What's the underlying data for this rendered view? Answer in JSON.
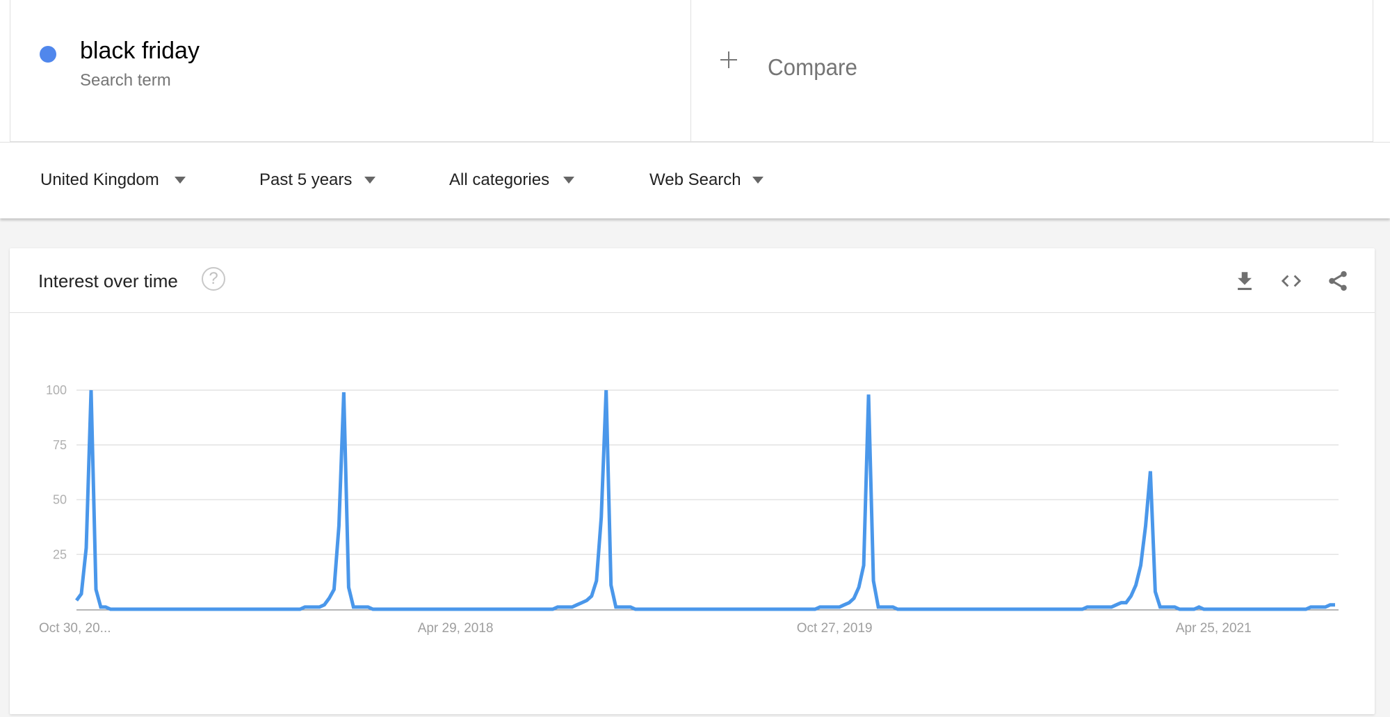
{
  "search_term": {
    "label": "black friday",
    "type_label": "Search term",
    "color": "#5087ec"
  },
  "compare": {
    "label": "Compare",
    "icon": "plus-icon"
  },
  "filters": [
    {
      "label": "United Kingdom",
      "icon": "caret-down-icon"
    },
    {
      "label": "Past 5 years",
      "icon": "caret-down-icon"
    },
    {
      "label": "All categories",
      "icon": "caret-down-icon"
    },
    {
      "label": "Web Search",
      "icon": "caret-down-icon"
    }
  ],
  "panel": {
    "title": "Interest over time",
    "help_icon": "?",
    "actions": [
      {
        "name": "download",
        "icon": "download-icon"
      },
      {
        "name": "embed",
        "icon": "code-icon"
      },
      {
        "name": "share",
        "icon": "share-icon"
      }
    ]
  },
  "chart_data": {
    "type": "line",
    "title": "Interest over time",
    "xlabel": "",
    "ylabel": "",
    "ylim": [
      0,
      100
    ],
    "grid": true,
    "y_ticks": [
      100,
      75,
      50,
      25
    ],
    "x_tick_labels": [
      {
        "label": "Oct 30, 20...",
        "index": 0
      },
      {
        "label": "Apr 29, 2018",
        "index": 78
      },
      {
        "label": "Oct 27, 2019",
        "index": 156
      },
      {
        "label": "Apr 25, 2021",
        "index": 234
      }
    ],
    "line_color": "#4a97ea",
    "series": [
      {
        "name": "black friday",
        "values": [
          4,
          7,
          28,
          100,
          9,
          1,
          1,
          0,
          0,
          0,
          0,
          0,
          0,
          0,
          0,
          0,
          0,
          0,
          0,
          0,
          0,
          0,
          0,
          0,
          0,
          0,
          0,
          0,
          0,
          0,
          0,
          0,
          0,
          0,
          0,
          0,
          0,
          0,
          0,
          0,
          0,
          0,
          0,
          0,
          0,
          0,
          0,
          1,
          1,
          1,
          1,
          2,
          5,
          9,
          38,
          99,
          10,
          1,
          1,
          1,
          1,
          0,
          0,
          0,
          0,
          0,
          0,
          0,
          0,
          0,
          0,
          0,
          0,
          0,
          0,
          0,
          0,
          0,
          0,
          0,
          0,
          0,
          0,
          0,
          0,
          0,
          0,
          0,
          0,
          0,
          0,
          0,
          0,
          0,
          0,
          0,
          0,
          0,
          0,
          1,
          1,
          1,
          1,
          2,
          3,
          4,
          6,
          13,
          42,
          100,
          11,
          1,
          1,
          1,
          1,
          0,
          0,
          0,
          0,
          0,
          0,
          0,
          0,
          0,
          0,
          0,
          0,
          0,
          0,
          0,
          0,
          0,
          0,
          0,
          0,
          0,
          0,
          0,
          0,
          0,
          0,
          0,
          0,
          0,
          0,
          0,
          0,
          0,
          0,
          0,
          0,
          0,
          0,
          1,
          1,
          1,
          1,
          1,
          2,
          3,
          5,
          10,
          20,
          98,
          13,
          1,
          1,
          1,
          1,
          0,
          0,
          0,
          0,
          0,
          0,
          0,
          0,
          0,
          0,
          0,
          0,
          0,
          0,
          0,
          0,
          0,
          0,
          0,
          0,
          0,
          0,
          0,
          0,
          0,
          0,
          0,
          0,
          0,
          0,
          0,
          0,
          0,
          0,
          0,
          0,
          0,
          0,
          0,
          1,
          1,
          1,
          1,
          1,
          1,
          2,
          3,
          3,
          6,
          11,
          20,
          38,
          63,
          8,
          1,
          1,
          1,
          1,
          0,
          0,
          0,
          0,
          1,
          0,
          0,
          0,
          0,
          0,
          0,
          0,
          0,
          0,
          0,
          0,
          0,
          0,
          0,
          0,
          0,
          0,
          0,
          0,
          0,
          0,
          0,
          1,
          1,
          1,
          1,
          2,
          2
        ]
      }
    ]
  }
}
